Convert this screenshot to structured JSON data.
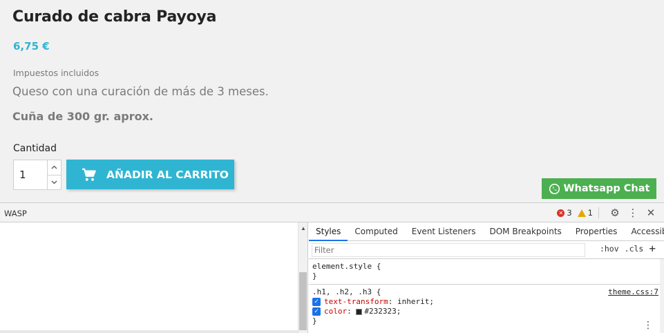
{
  "product": {
    "title": "Curado de cabra Payoya",
    "price": "6,75 €",
    "tax_note": "Impuestos incluidos",
    "description": "Queso con una curación de más de 3 meses.",
    "weight_note": "Cuña de 300 gr. aprox.",
    "quantity_label": "Cantidad",
    "quantity_value": "1",
    "add_to_cart_label": "AÑADIR AL CARRITO",
    "whatsapp_label": "Whatsapp Chat",
    "colors": {
      "accent": "#2fb5d2",
      "whatsapp": "#4caf50",
      "text": "#232323"
    }
  },
  "devtools": {
    "dock_name": "WASP",
    "error_count": "3",
    "warning_count": "1",
    "tabs": [
      "Styles",
      "Computed",
      "Event Listeners",
      "DOM Breakpoints",
      "Properties",
      "Accessibility"
    ],
    "active_tab": "Styles",
    "filter_placeholder": "Filter",
    "hov_label": ":hov",
    "cls_label": ".cls",
    "rules": {
      "element_style": {
        "selector": "element.style {",
        "close": "}"
      },
      "theme": {
        "selector": ".h1, .h2, .h3 {",
        "source": "theme.css:7",
        "decl1_prop": "text-transform",
        "decl1_val": "inherit;",
        "decl2_prop": "color",
        "decl2_val": "#232323;",
        "close": "}"
      }
    }
  }
}
